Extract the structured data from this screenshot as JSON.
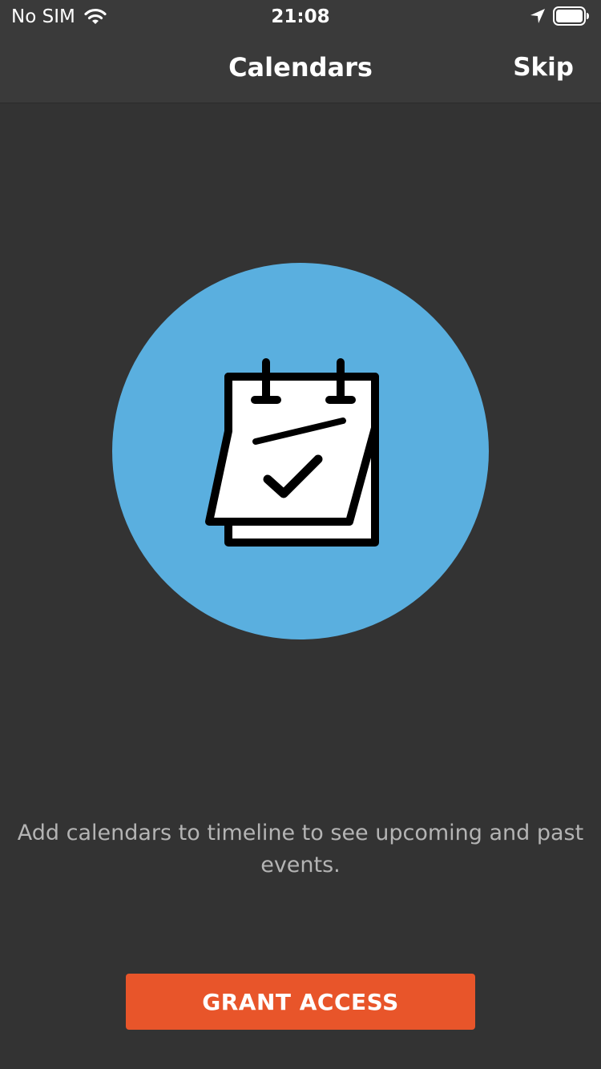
{
  "status_bar": {
    "carrier": "No SIM",
    "time": "21:08",
    "icons": [
      "wifi-icon",
      "location-icon",
      "battery-icon"
    ]
  },
  "nav": {
    "title": "Calendars",
    "skip_label": "Skip"
  },
  "hero": {
    "icon": "calendar-check-icon",
    "circle_color": "#5aafdf"
  },
  "main": {
    "description": "Add calendars to timeline to see upcoming and past events."
  },
  "actions": {
    "grant_label": "GRANT ACCESS",
    "grant_color": "#e8552a"
  },
  "colors": {
    "background": "#333333",
    "bar": "#3a3a3a",
    "text_secondary": "#b4b4b4"
  }
}
